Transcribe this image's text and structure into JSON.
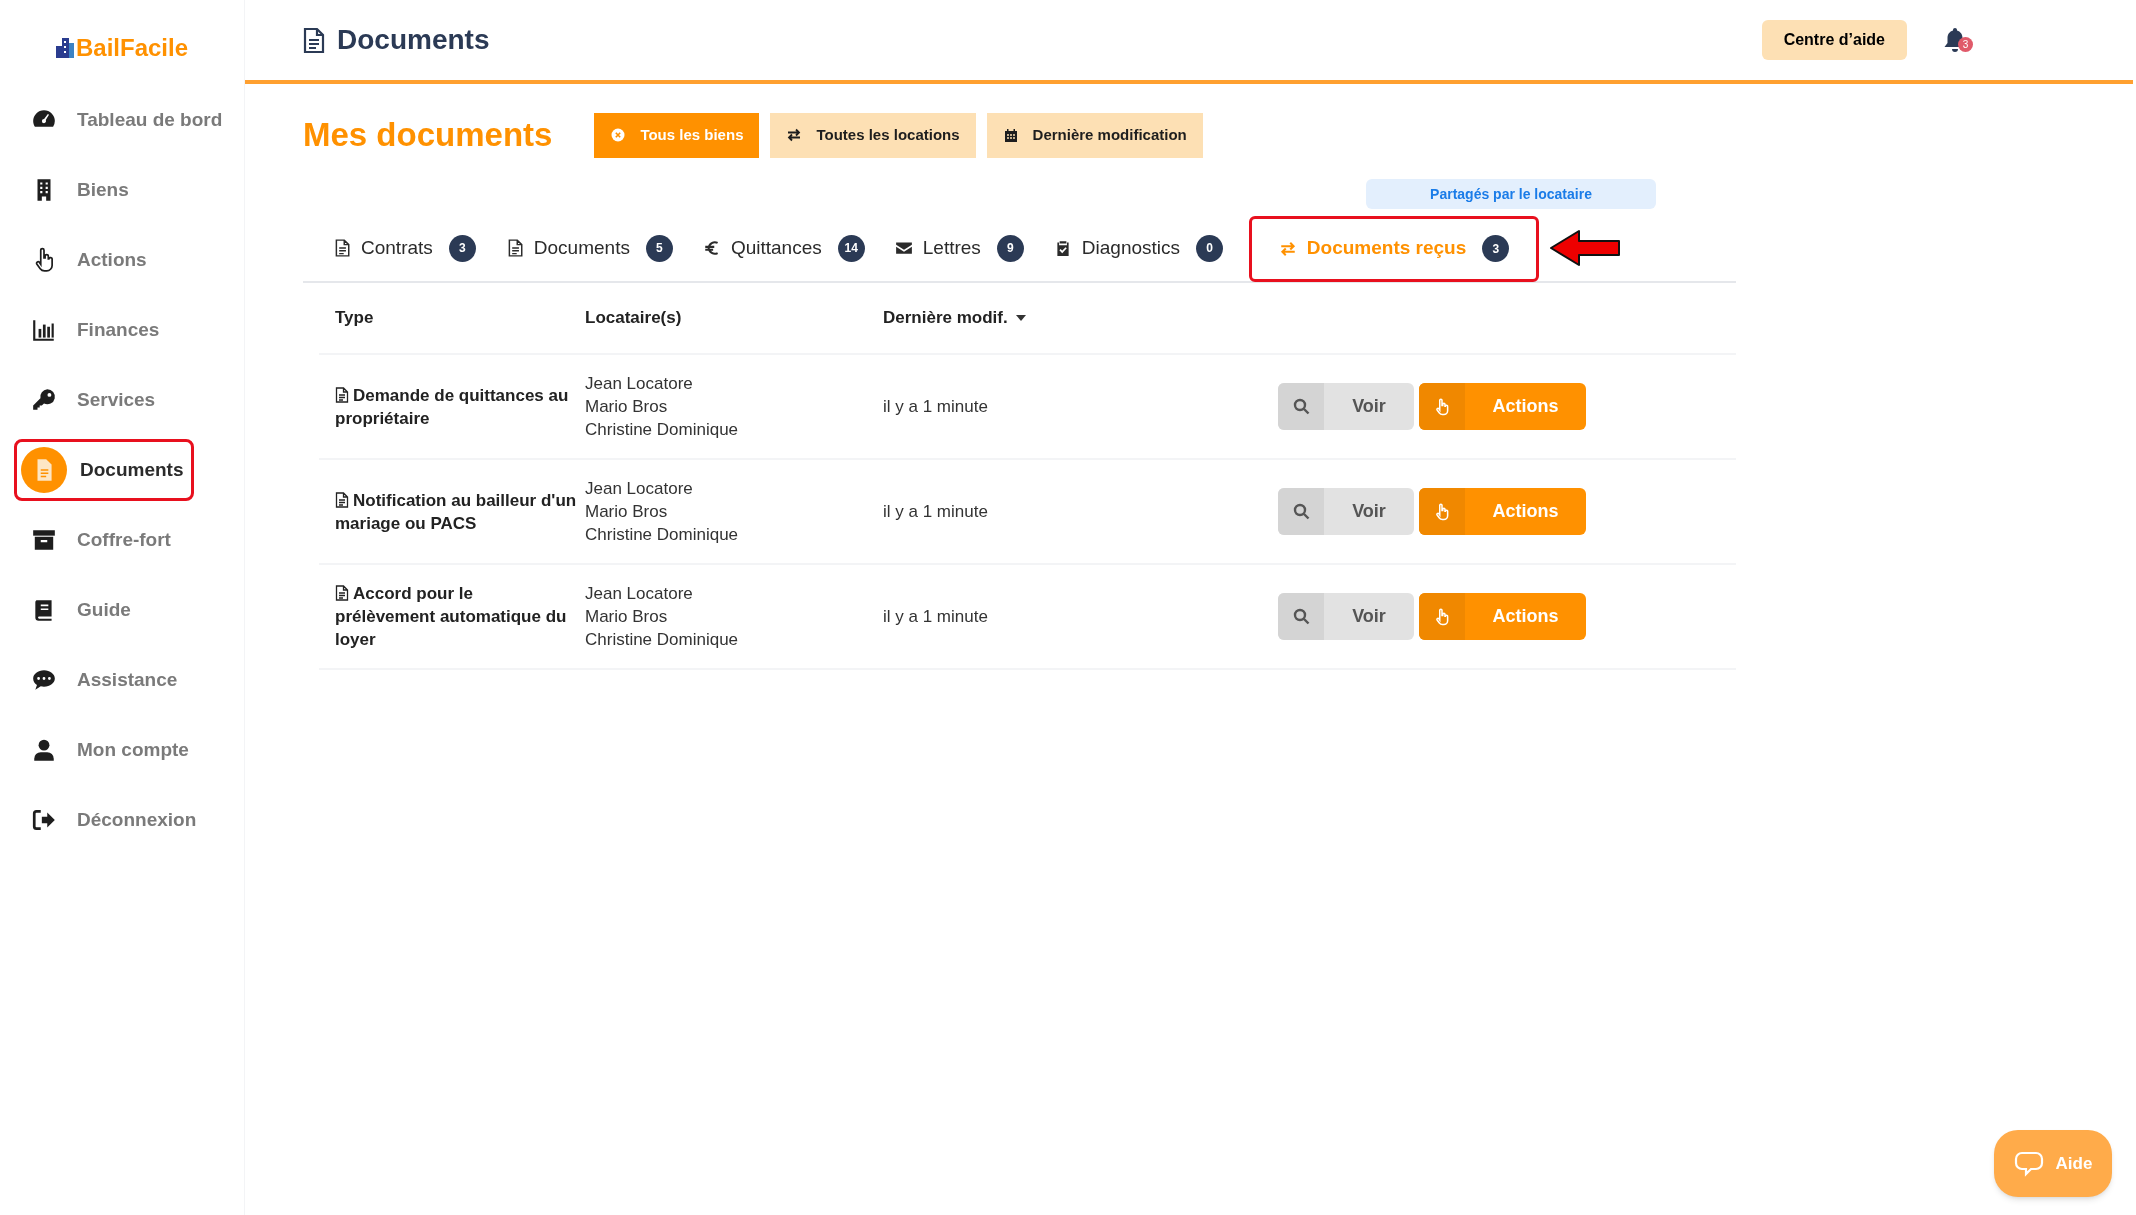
{
  "logo": {
    "text": "BailFacile"
  },
  "sidebar": {
    "items": [
      {
        "label": "Tableau de bord",
        "selected": false
      },
      {
        "label": "Biens",
        "selected": false
      },
      {
        "label": "Actions",
        "selected": false
      },
      {
        "label": "Finances",
        "selected": false
      },
      {
        "label": "Services",
        "selected": false
      },
      {
        "label": "Documents",
        "selected": true
      },
      {
        "label": "Coffre-fort",
        "selected": false
      },
      {
        "label": "Guide",
        "selected": false
      },
      {
        "label": "Assistance",
        "selected": false
      },
      {
        "label": "Mon compte",
        "selected": false
      },
      {
        "label": "Déconnexion",
        "selected": false
      }
    ]
  },
  "header": {
    "title": "Documents",
    "help_button": "Centre d’aide",
    "notification_count": "3"
  },
  "page": {
    "title": "Mes documents",
    "filters": [
      {
        "label": "Tous les biens",
        "active": true
      },
      {
        "label": "Toutes les locations",
        "active": false
      },
      {
        "label": "Dernière modification",
        "active": false
      }
    ],
    "tab_note": "Partagés par le locataire",
    "tabs": [
      {
        "label": "Contrats",
        "count": "3",
        "selected": false
      },
      {
        "label": "Documents",
        "count": "5",
        "selected": false
      },
      {
        "label": "Quittances",
        "count": "14",
        "selected": false
      },
      {
        "label": "Lettres",
        "count": "9",
        "selected": false
      },
      {
        "label": "Diagnostics",
        "count": "0",
        "selected": false
      },
      {
        "label": "Documents reçus",
        "count": "3",
        "selected": true
      }
    ]
  },
  "table": {
    "columns": [
      "Type",
      "Locataire(s)",
      "Dernière modif."
    ],
    "rows": [
      {
        "type": "Demande de quittances au propriétaire",
        "tenants": [
          "Jean Locatore",
          "Mario Bros",
          "Christine Dominique"
        ],
        "modified": "il y a 1 minute",
        "view": "Voir",
        "actions": "Actions"
      },
      {
        "type": "Notification au bailleur d'un mariage ou PACS",
        "tenants": [
          "Jean Locatore",
          "Mario Bros",
          "Christine Dominique"
        ],
        "modified": "il y a 1 minute",
        "view": "Voir",
        "actions": "Actions"
      },
      {
        "type": "Accord pour le prélèvement automatique du loyer",
        "tenants": [
          "Jean Locatore",
          "Mario Bros",
          "Christine Dominique"
        ],
        "modified": "il y a 1 minute",
        "view": "Voir",
        "actions": "Actions"
      }
    ]
  },
  "help_widget": {
    "label": "Aide"
  }
}
